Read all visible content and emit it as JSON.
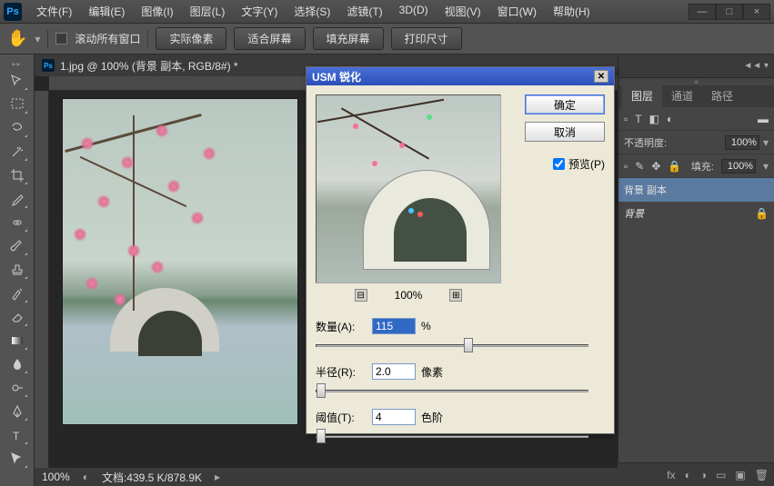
{
  "app": {
    "logo": "Ps"
  },
  "menu": [
    "文件(F)",
    "编辑(E)",
    "图像(I)",
    "图层(L)",
    "文字(Y)",
    "选择(S)",
    "滤镜(T)",
    "3D(D)",
    "视图(V)",
    "窗口(W)",
    "帮助(H)"
  ],
  "window_controls": {
    "min": "—",
    "max": "□",
    "close": "×"
  },
  "options": {
    "scroll_all": "滚动所有窗口",
    "buttons": [
      "实际像素",
      "适合屏幕",
      "填充屏幕",
      "打印尺寸"
    ]
  },
  "document": {
    "title": "1.jpg @ 100% (背景 副本, RGB/8#) *",
    "zoom": "100%",
    "status": "文档:439.5 K/878.9K"
  },
  "panels": {
    "tabs": [
      "图层",
      "通道",
      "路径"
    ],
    "opacity_label": "不透明度:",
    "opacity_value": "100%",
    "fill_label": "填充:",
    "fill_value": "100%",
    "layers": [
      {
        "name": "背景 副本",
        "selected": true,
        "locked": false
      },
      {
        "name": "背景",
        "selected": false,
        "locked": true
      }
    ]
  },
  "dialog": {
    "title": "USM 锐化",
    "ok": "确定",
    "cancel": "取消",
    "preview_label": "预览(P)",
    "preview_checked": true,
    "zoom": "100%",
    "sliders": {
      "amount": {
        "label": "数量(A):",
        "value": "115",
        "unit": "%",
        "pos": 56
      },
      "radius": {
        "label": "半径(R):",
        "value": "2.0",
        "unit": "像素",
        "pos": 2
      },
      "threshold": {
        "label": "阈值(T):",
        "value": "4",
        "unit": "色阶",
        "pos": 2
      }
    }
  }
}
